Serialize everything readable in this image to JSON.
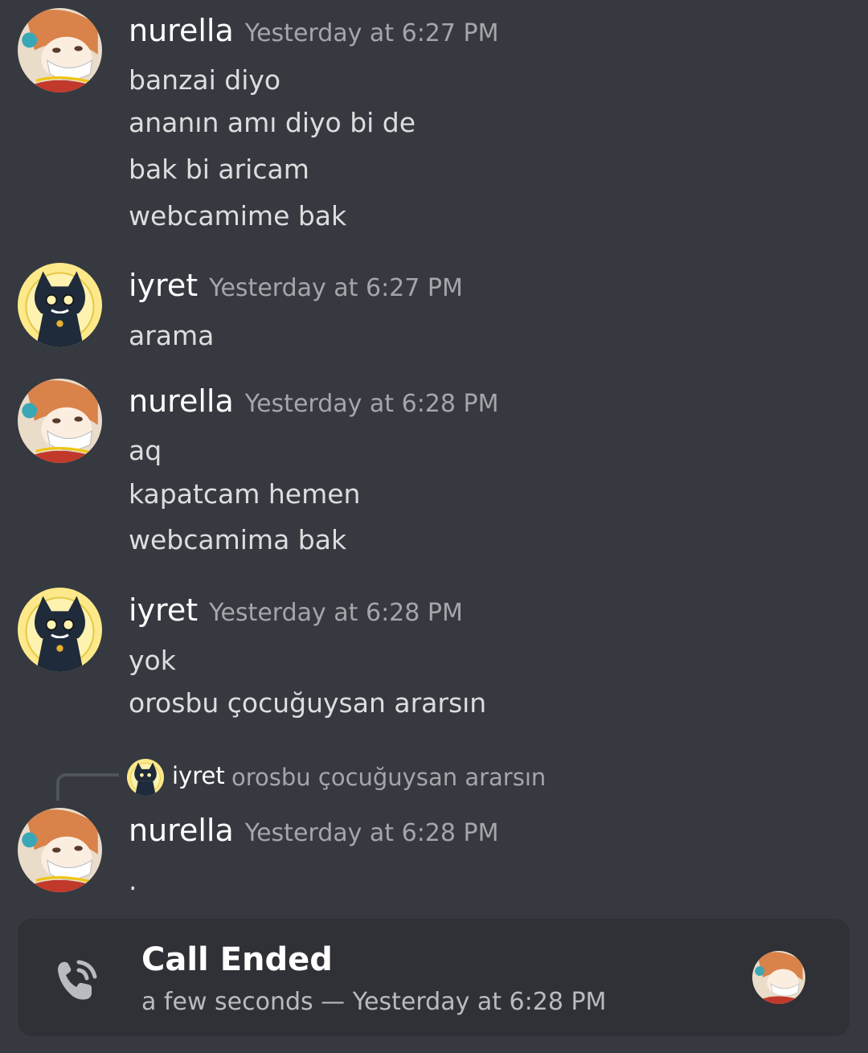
{
  "messages": [
    {
      "username": "nurella",
      "timestamp": "Yesterday at 6:27 PM",
      "lines": [
        "banzai diyo",
        "ananın amı diyo bi de",
        "bak bi aricam",
        "webcamime bak"
      ]
    },
    {
      "username": "iyret",
      "timestamp": "Yesterday at 6:27 PM",
      "lines": [
        "arama"
      ]
    },
    {
      "username": "nurella",
      "timestamp": "Yesterday at 6:28 PM",
      "lines": [
        "aq",
        "kapatcam hemen",
        "webcamima bak"
      ]
    },
    {
      "username": "iyret",
      "timestamp": "Yesterday at 6:28 PM",
      "lines": [
        "yok",
        "orosbu çocuğuysan ararsın"
      ]
    },
    {
      "username": "nurella",
      "timestamp": "Yesterday at 6:28 PM",
      "lines": [
        "."
      ]
    }
  ],
  "reply": {
    "username": "iyret",
    "text": "orosbu çocuğuysan ararsın"
  },
  "call": {
    "title": "Call Ended",
    "subtitle": "a few seconds — Yesterday at 6:28 PM"
  },
  "icons": {
    "call": "phone-call-icon",
    "avatar_nurella": "anime-girl-avatar",
    "avatar_iyret": "black-cat-avatar"
  },
  "colors": {
    "background": "#36393f",
    "card": "#2f3136",
    "username": "#ffffff",
    "timestamp": "#a3a6aa",
    "text": "#dcddde"
  }
}
